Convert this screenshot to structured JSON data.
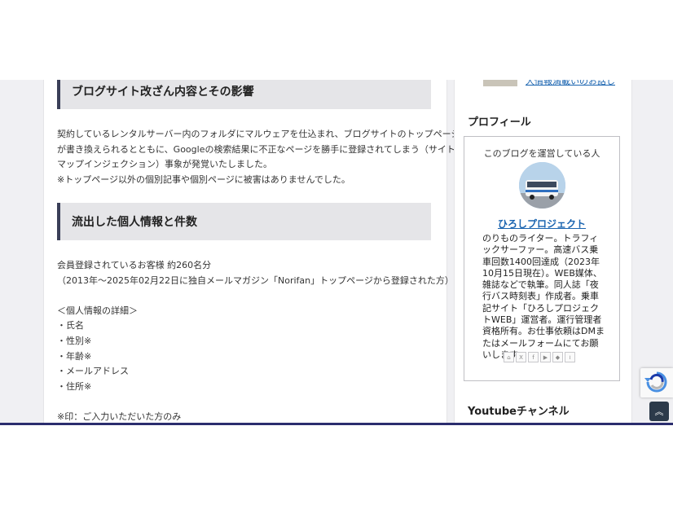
{
  "article": {
    "heading1": "ブログサイト改ざん内容とその影響",
    "para1": [
      "契約しているレンタルサーバー内のフォルダにマルウェアを仕込まれ、ブログサイトのトップページ",
      "が書き換えられるとともに、Googleの検索結果に不正なページを勝手に登録されてしまう（サイト",
      "マップインジェクション）事象が発覚いたしました。",
      "※トップページ以外の個別記事や個別ページに被害はありませんでした。"
    ],
    "heading2": "流出した個人情報と件数",
    "para2": [
      "会員登録されているお客様 約260名分",
      "（2013年〜2025年02月22日に独自メールマガジン「Norifan」トップページから登録された方）",
      "",
      "＜個人情報の詳細＞",
      "・氏名",
      "・性別※",
      "・年齢※",
      "・メールアドレス",
      "・住所※",
      "",
      "※印：ご入力いただいた方のみ"
    ]
  },
  "sidebar": {
    "partial_link": "大情報満載いのお話し",
    "profile_title": "プロフィール",
    "profile_caption": "このブログを運営している人",
    "profile_name": "ひろしプロジェクト",
    "profile_bio": "のりものライター。トラフィックサーファー。高速バス乗車回数1400回達成（2023年10月15日現在）。WEB媒体、雑誌などで執筆。同人誌「夜行バス時刻表」作成者。乗車記サイト「ひろしプロジェクトWEB」運営者。運行管理者資格所有。お仕事依頼はDMまたはメールフォームにてお願いします。",
    "social_icons": [
      "home-icon",
      "x-icon",
      "facebook-icon",
      "youtube-icon",
      "feedly-icon",
      "rss-icon"
    ],
    "youtube_title": "Youtubeチャンネル"
  },
  "colors": {
    "link": "#1a64b0",
    "heading_bg": "#e5e5e8",
    "heading_border": "#3a3f58",
    "page_bg": "#f0f0f3",
    "totop_bg": "#2c3a4a"
  }
}
